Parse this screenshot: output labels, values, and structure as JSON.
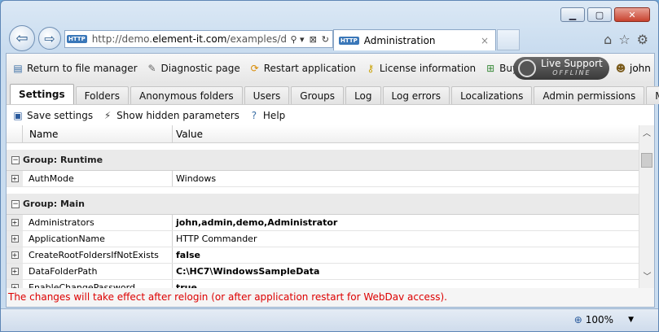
{
  "browser": {
    "url_prefix": "http://demo.",
    "url_domain": "element-it.com",
    "url_rest": "/examples/de",
    "address_icons": [
      "⚲ ▾",
      "⊠",
      "↻"
    ],
    "http_badge": "HTTP",
    "tab_title": "Administration",
    "tab_close": "×"
  },
  "window_controls": {
    "minimize": "▁",
    "maximize": "▢",
    "close": "✕"
  },
  "toolbar": {
    "items": [
      {
        "label": "Return to file manager",
        "icon": "file-manager-icon",
        "glyph": "▤"
      },
      {
        "label": "Diagnostic page",
        "icon": "wrench-icon",
        "glyph": "🔧"
      },
      {
        "label": "Restart application",
        "icon": "restart-icon",
        "glyph": "↺"
      },
      {
        "label": "License information",
        "icon": "key-icon",
        "glyph": "🔑"
      },
      {
        "label": "Buy now",
        "icon": "cart-icon",
        "glyph": "🛒"
      }
    ],
    "live_support": {
      "line1": "Live Support",
      "line2": "OFFLINE"
    },
    "user": "john"
  },
  "tabs": [
    {
      "label": "Settings",
      "active": true
    },
    {
      "label": "Folders"
    },
    {
      "label": "Anonymous folders"
    },
    {
      "label": "Users"
    },
    {
      "label": "Groups"
    },
    {
      "label": "Log"
    },
    {
      "label": "Log errors"
    },
    {
      "label": "Localizations"
    },
    {
      "label": "Admin permissions"
    },
    {
      "label": "Misc"
    }
  ],
  "subtoolbar": {
    "save": "Save settings",
    "show_hidden": "Show hidden parameters",
    "help": "Help"
  },
  "grid": {
    "columns": {
      "name": "Name",
      "value": "Value"
    },
    "groups": [
      {
        "title": "Group: Runtime",
        "rows": [
          {
            "name": "AuthMode",
            "value": "Windows",
            "bold": false
          }
        ]
      },
      {
        "title": "Group: Main",
        "rows": [
          {
            "name": "Administrators",
            "value": "john,admin,demo,Administrator",
            "bold": true
          },
          {
            "name": "ApplicationName",
            "value": "HTTP Commander",
            "bold": false
          },
          {
            "name": "CreateRootFoldersIfNotExists",
            "value": "false",
            "bold": true
          },
          {
            "name": "DataFolderPath",
            "value": "C:\\HC7\\WindowsSampleData",
            "bold": true
          },
          {
            "name": "EnableChangePassword",
            "value": "true",
            "bold": true
          }
        ]
      }
    ]
  },
  "notice": "The changes will take effect after relogin (or after application restart for WebDav access).",
  "status": {
    "zoom": "100%"
  },
  "colors": {
    "notice": "#dd0000",
    "accent": "#3a77b8"
  }
}
